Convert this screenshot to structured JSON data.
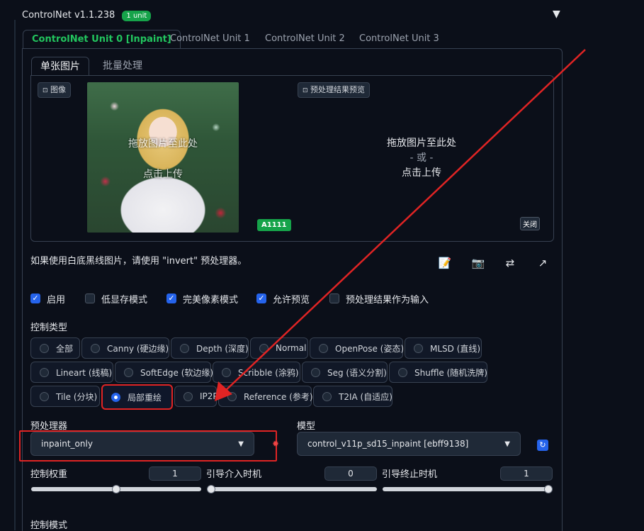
{
  "header": {
    "title": "ControlNet v1.1.238",
    "unit_badge": "1 unit",
    "collapse_icon": "triangle-down-icon"
  },
  "unit_tabs": [
    {
      "label": "ControlNet Unit 0 [Inpaint]",
      "active": true
    },
    {
      "label": "ControlNet Unit 1",
      "active": false
    },
    {
      "label": "ControlNet Unit 2",
      "active": false
    },
    {
      "label": "ControlNet Unit 3",
      "active": false
    }
  ],
  "sub_tabs": [
    {
      "label": "单张图片",
      "active": true
    },
    {
      "label": "批量处理",
      "active": false
    }
  ],
  "image_panel": {
    "input_label": "图像",
    "input_overlay_line1": "拖放图片至此处",
    "input_overlay_line2": "点击上传",
    "a1111_badge": "A1111",
    "preview_label": "预处理结果预览",
    "drop_line1": "拖放图片至此处",
    "drop_line2": "- 或 -",
    "drop_line3": "点击上传",
    "close_label": "关闭"
  },
  "hint": "如果使用白底黑线图片，请使用 \"invert\" 预处理器。",
  "tool_icons": [
    "notepad-icon",
    "camera-icon",
    "swap-icon",
    "send-arrow-icon"
  ],
  "checkboxes": [
    {
      "label": "启用",
      "checked": true
    },
    {
      "label": "低显存模式",
      "checked": false
    },
    {
      "label": "完美像素模式",
      "checked": true
    },
    {
      "label": "允许预览",
      "checked": true
    },
    {
      "label": "预处理结果作为输入",
      "checked": false
    }
  ],
  "control_type": {
    "label": "控制类型",
    "rows": [
      [
        {
          "label": "全部",
          "selected": false
        },
        {
          "label": "Canny (硬边缘)",
          "selected": false
        },
        {
          "label": "Depth (深度)",
          "selected": false
        },
        {
          "label": "Normal",
          "selected": false
        },
        {
          "label": "OpenPose (姿态)",
          "selected": false
        },
        {
          "label": "MLSD (直线)",
          "selected": false
        }
      ],
      [
        {
          "label": "Lineart (线稿)",
          "selected": false
        },
        {
          "label": "SoftEdge (软边缘)",
          "selected": false
        },
        {
          "label": "Scribble (涂鸦)",
          "selected": false
        },
        {
          "label": "Seg (语义分割)",
          "selected": false
        },
        {
          "label": "Shuffle (随机洗牌)",
          "selected": false
        }
      ],
      [
        {
          "label": "Tile (分块)",
          "selected": false
        },
        {
          "label": "局部重绘",
          "selected": true
        },
        {
          "label": "IP2P",
          "selected": false
        },
        {
          "label": "Reference (参考)",
          "selected": false
        },
        {
          "label": "T2IA (自适应)",
          "selected": false
        }
      ]
    ]
  },
  "preprocessor": {
    "label": "预处理器",
    "value": "inpaint_only",
    "run_icon": "explosion-icon"
  },
  "model": {
    "label": "模型",
    "value": "control_v11p_sd15_inpaint [ebff9138]",
    "refresh_icon": "refresh-icon"
  },
  "sliders": [
    {
      "label": "控制权重",
      "value": "1",
      "fraction": 0.5
    },
    {
      "label": "引导介入时机",
      "value": "0",
      "fraction": 0.0
    },
    {
      "label": "引导终止时机",
      "value": "1",
      "fraction": 1.0
    }
  ],
  "control_mode_label": "控制模式",
  "colors": {
    "background": "#0b0f19",
    "accent_green": "#22c55e",
    "accent_blue": "#2563eb",
    "annotation_red": "#e02424"
  }
}
